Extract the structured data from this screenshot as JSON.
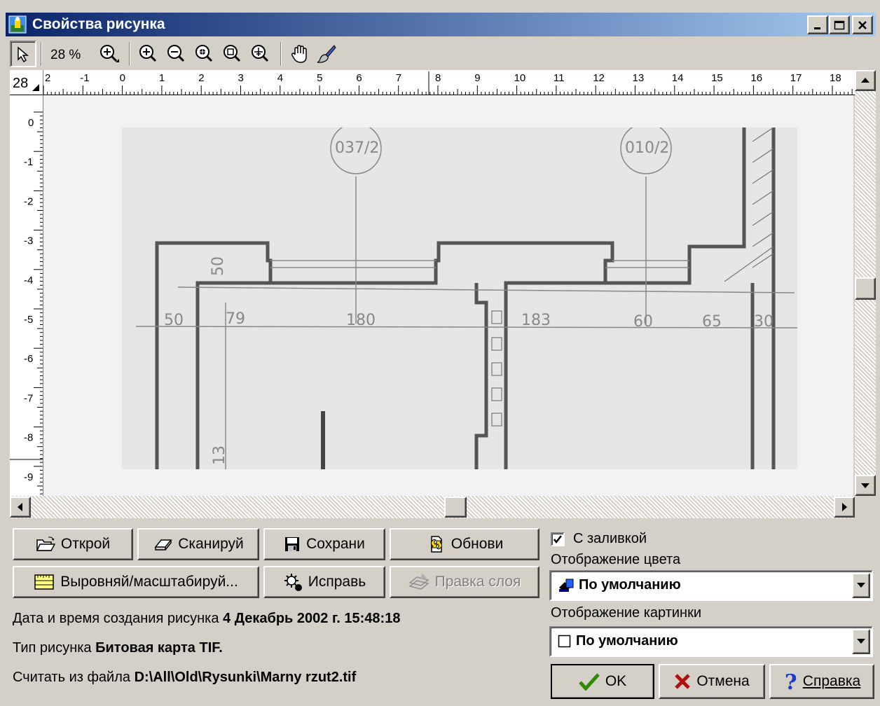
{
  "window": {
    "title": "Свойства рисунка"
  },
  "toolbar": {
    "zoom_label": "28 %",
    "tools": [
      "select-arrow-icon",
      "zoom-tool-icon",
      "zoom-in-icon",
      "zoom-out-icon",
      "zoom-window-icon",
      "zoom-fit-icon",
      "zoom-all-icon",
      "pan-hand-icon",
      "brush-icon"
    ]
  },
  "ruler": {
    "corner_label": "28",
    "h_labels": [
      "2",
      "-1",
      "0",
      "1",
      "2",
      "3",
      "4",
      "5",
      "6",
      "7",
      "8",
      "9",
      "10",
      "11",
      "12",
      "13",
      "14",
      "15",
      "16",
      "17",
      "18"
    ],
    "v_labels": [
      "0",
      "-1",
      "-2",
      "-3",
      "-4",
      "-5",
      "-6",
      "-7",
      "-8",
      "-9"
    ]
  },
  "drawing": {
    "circle_labels": [
      "037/2",
      "010/2"
    ],
    "dimensions": [
      "50",
      "79",
      "180",
      "183",
      "60",
      "65",
      "30",
      "50",
      "13"
    ]
  },
  "buttons": {
    "open": "Открой",
    "scan": "Сканируй",
    "save": "Сохрани",
    "refresh": "Обнови",
    "align_scale": "Выровняй/масштабируй...",
    "fix": "Исправь",
    "edit_layer": "Правка слоя",
    "ok": "OK",
    "cancel": "Отмена",
    "help": "Справка"
  },
  "info": {
    "created_label": "Дата и время создания рисунка",
    "created_value": "4 Декабрь 2002 г. 15:48:18",
    "type_label": "Тип рисунка",
    "type_value": "Битовая карта TIF.",
    "file_label": "Считать из файла",
    "file_value": "D:\\All\\Old\\Rysunki\\Marny rzut2.tif"
  },
  "options": {
    "fill_label": "С заливкой",
    "fill_checked": true,
    "color_display_label": "Отображение цвета",
    "color_display_value": "По умолчанию",
    "picture_display_label": "Отображение картинки",
    "picture_display_value": "По умолчанию"
  }
}
